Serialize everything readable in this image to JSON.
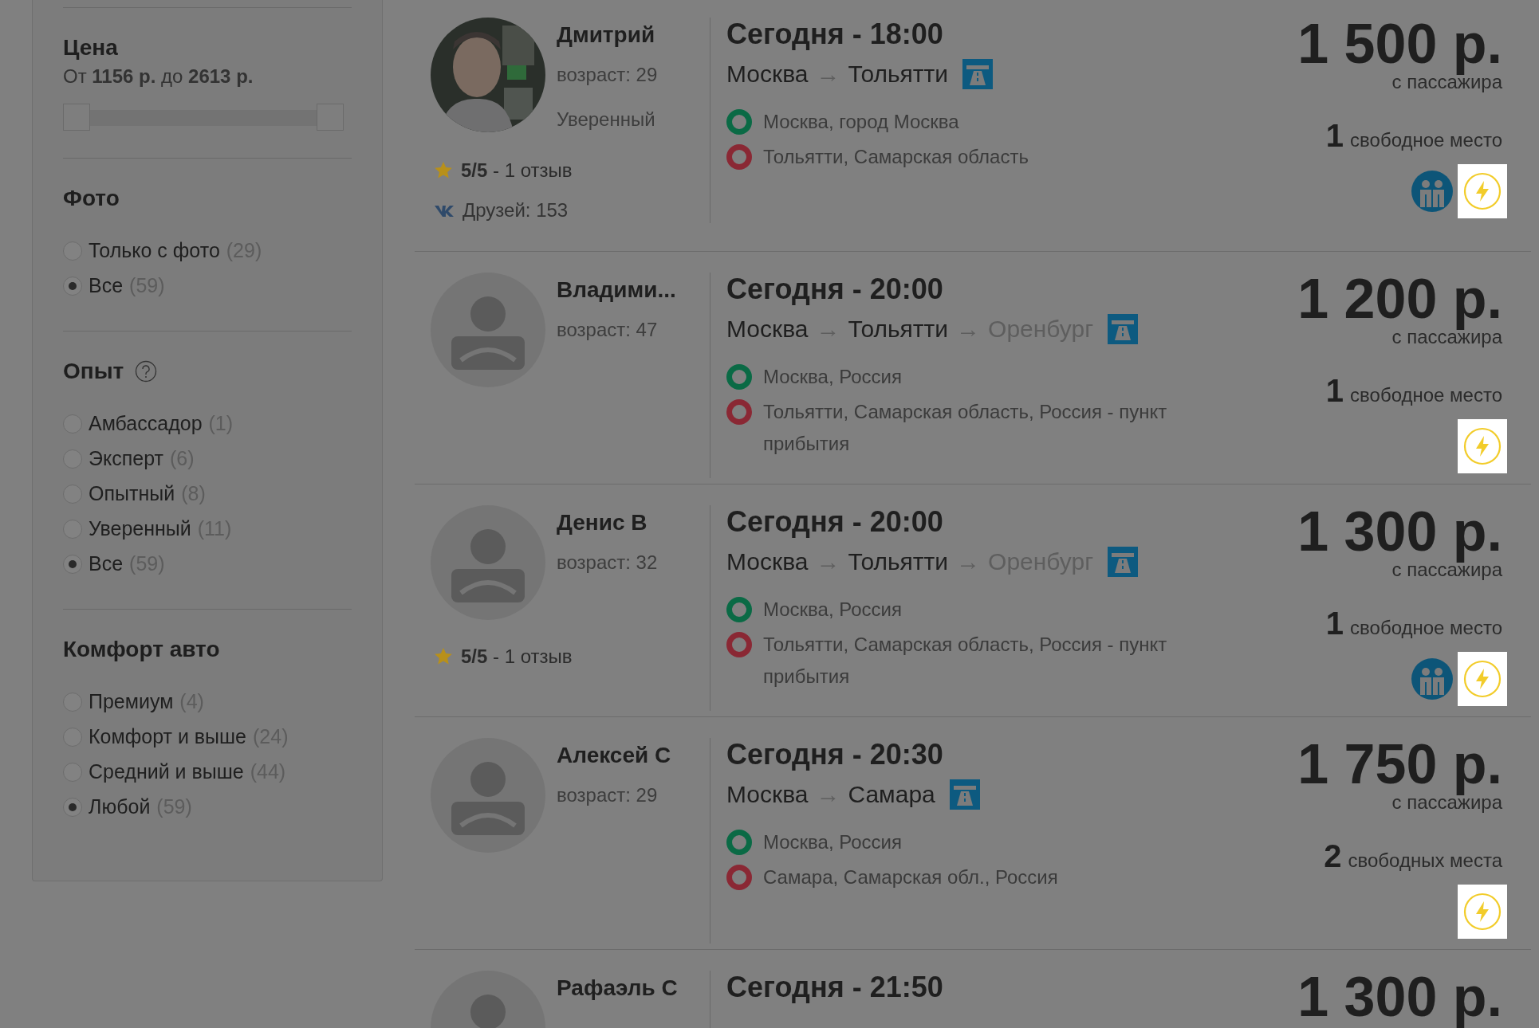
{
  "filters": {
    "price": {
      "title": "Цена",
      "range_text": "От **1156 р.** до **2613 р.**",
      "thumbs": [
        {
          "level": 0
        },
        {
          "level": 1
        }
      ]
    },
    "groups": [
      {
        "title": "Фото",
        "help": false,
        "options": [
          {
            "label": "Только с фото",
            "count": "(29)",
            "selected": false
          },
          {
            "label": "Все",
            "count": "(59)",
            "selected": true
          }
        ]
      },
      {
        "title": "Опыт",
        "help": true,
        "options": [
          {
            "label": "Амбассадор",
            "count": "(1)",
            "selected": false
          },
          {
            "label": "Эксперт",
            "count": "(6)",
            "selected": false
          },
          {
            "label": "Опытный",
            "count": "(8)",
            "selected": false
          },
          {
            "label": "Уверенный",
            "count": "(11)",
            "selected": false
          },
          {
            "label": "Все",
            "count": "(59)",
            "selected": true
          }
        ]
      },
      {
        "title": "Комфорт авто",
        "help": false,
        "options": [
          {
            "label": "Премиум",
            "count": "(4)",
            "selected": false
          },
          {
            "label": "Комфорт и выше",
            "count": "(24)",
            "selected": false
          },
          {
            "label": "Средний и выше",
            "count": "(44)",
            "selected": false
          },
          {
            "label": "Любой",
            "count": "(59)",
            "selected": true
          }
        ]
      }
    ]
  },
  "trips": [
    {
      "driver": {
        "name": "Дмитрий",
        "age": "возраст: 29",
        "experience": "Уверенный",
        "rating": "**5/5** - 1 отзыв",
        "friends": "Друзей: 153"
      },
      "time": "Сегодня - 18:00",
      "route": [
        {
          "text": "Москва",
          "muted": false
        },
        {
          "text": "→",
          "muted": true
        },
        {
          "text": "Тольятти",
          "muted": false
        }
      ],
      "stops": [
        {
          "kind": "from",
          "text": "Москва, город Москва"
        },
        {
          "kind": "to",
          "text": "Тольятти, Самарская область"
        }
      ],
      "price": "1 500 р.",
      "price_note": "с пассажира",
      "seats_count": "1",
      "seats_label": "свободное место",
      "badges": [
        {
          "kind": "people"
        },
        {
          "kind": "lightning"
        }
      ]
    },
    {
      "driver": {
        "avatar": {
          "kind": "placeholder"
        },
        "name": "Владими...",
        "age": "возраст: 47"
      },
      "time": "Сегодня - 20:00",
      "route": [
        {
          "text": "Москва",
          "muted": false
        },
        {
          "text": "→",
          "muted": true
        },
        {
          "text": "Тольятти",
          "muted": false
        },
        {
          "text": "→",
          "muted": true
        },
        {
          "text": "Оренбург",
          "muted": true
        }
      ],
      "stops": [
        {
          "kind": "from",
          "text": "Москва, Россия"
        },
        {
          "kind": "to",
          "text": "Тольятти, Самарская область, Россия - пункт прибытия"
        }
      ],
      "price": "1 200 р.",
      "price_note": "с пассажира",
      "seats_count": "1",
      "seats_label": "свободное место",
      "badges": [
        {
          "kind": "lightning"
        }
      ]
    },
    {
      "driver": {
        "avatar": {
          "kind": "placeholder"
        },
        "name": "Денис В",
        "age": "возраст: 32",
        "rating": "**5/5** - 1 отзыв"
      },
      "time": "Сегодня - 20:00",
      "route": [
        {
          "text": "Москва",
          "muted": false
        },
        {
          "text": "→",
          "muted": true
        },
        {
          "text": "Тольятти",
          "muted": false
        },
        {
          "text": "→",
          "muted": true
        },
        {
          "text": "Оренбург",
          "muted": true
        }
      ],
      "stops": [
        {
          "kind": "from",
          "text": "Москва, Россия"
        },
        {
          "kind": "to",
          "text": "Тольятти, Самарская область, Россия - пункт прибытия"
        }
      ],
      "price": "1 300 р.",
      "price_note": "с пассажира",
      "seats_count": "1",
      "seats_label": "свободное место",
      "badges": [
        {
          "kind": "people"
        },
        {
          "kind": "lightning"
        }
      ]
    },
    {
      "driver": {
        "avatar": {
          "kind": "placeholder"
        },
        "name": "Алексей С",
        "age": "возраст: 29"
      },
      "time": "Сегодня - 20:30",
      "route": [
        {
          "text": "Москва",
          "muted": false
        },
        {
          "text": "→",
          "muted": true
        },
        {
          "text": "Самара",
          "muted": false
        }
      ],
      "stops": [
        {
          "kind": "from",
          "text": "Москва, Россия"
        },
        {
          "kind": "to",
          "text": "Самара, Самарская обл., Россия"
        }
      ],
      "price": "1 750 р.",
      "price_note": "с пассажира",
      "seats_count": "2",
      "seats_label": "свободных места",
      "badges": [
        {
          "kind": "lightning"
        }
      ]
    },
    {
      "driver": {
        "avatar": {
          "kind": "placeholder"
        },
        "name": "Рафаэль С"
      },
      "time": "Сегодня - 21:50",
      "price": "1 300 р."
    }
  ]
}
